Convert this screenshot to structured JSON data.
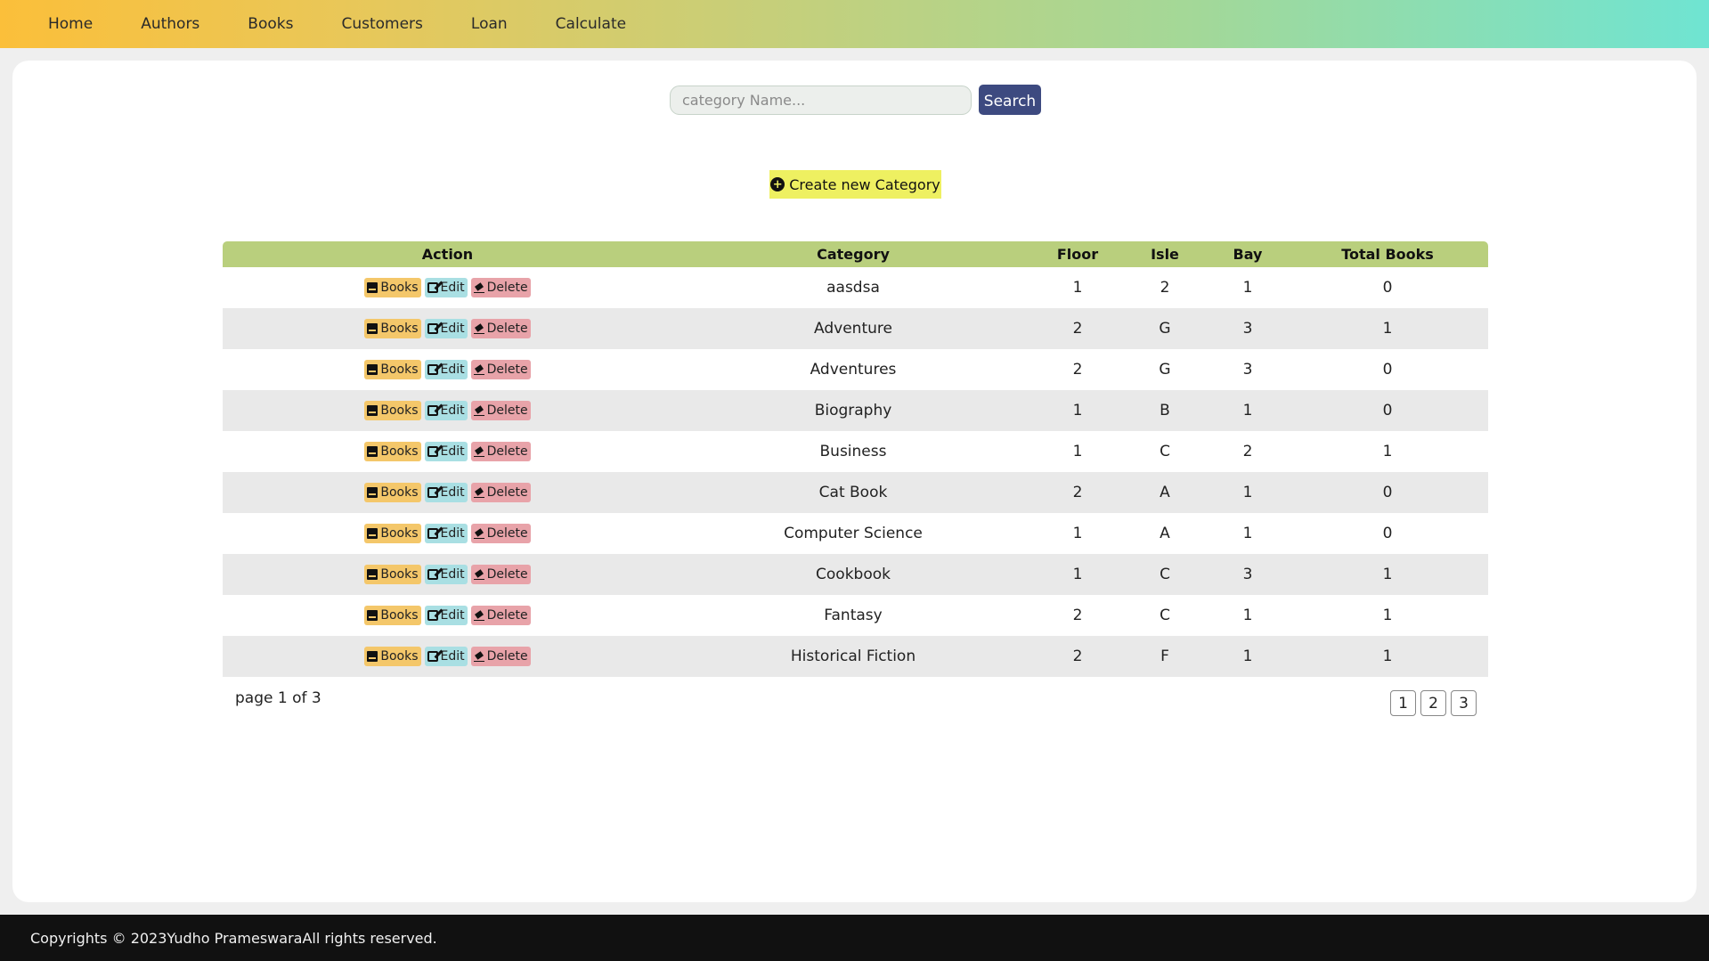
{
  "nav": {
    "items": [
      {
        "label": "Home"
      },
      {
        "label": "Authors"
      },
      {
        "label": "Books"
      },
      {
        "label": "Customers"
      },
      {
        "label": "Loan"
      },
      {
        "label": "Calculate"
      }
    ]
  },
  "search": {
    "placeholder": "category Name...",
    "value": "",
    "button_label": "Search"
  },
  "create_button": {
    "label": "Create new Category",
    "icon": "plus-circle-icon"
  },
  "table": {
    "columns": [
      "Action",
      "Category",
      "Floor",
      "Isle",
      "Bay",
      "Total Books"
    ],
    "action_labels": {
      "books": "Books",
      "edit": "Edit",
      "delete": "Delete"
    },
    "rows": [
      {
        "category": "aasdsa",
        "floor": "1",
        "isle": "2",
        "bay": "1",
        "total": "0"
      },
      {
        "category": "Adventure",
        "floor": "2",
        "isle": "G",
        "bay": "3",
        "total": "1"
      },
      {
        "category": "Adventures",
        "floor": "2",
        "isle": "G",
        "bay": "3",
        "total": "0"
      },
      {
        "category": "Biography",
        "floor": "1",
        "isle": "B",
        "bay": "1",
        "total": "0"
      },
      {
        "category": "Business",
        "floor": "1",
        "isle": "C",
        "bay": "2",
        "total": "1"
      },
      {
        "category": "Cat Book",
        "floor": "2",
        "isle": "A",
        "bay": "1",
        "total": "0"
      },
      {
        "category": "Computer Science",
        "floor": "1",
        "isle": "A",
        "bay": "1",
        "total": "0"
      },
      {
        "category": "Cookbook",
        "floor": "1",
        "isle": "C",
        "bay": "3",
        "total": "1"
      },
      {
        "category": "Fantasy",
        "floor": "2",
        "isle": "C",
        "bay": "1",
        "total": "1"
      },
      {
        "category": "Historical Fiction",
        "floor": "2",
        "isle": "F",
        "bay": "1",
        "total": "1"
      }
    ]
  },
  "pagination": {
    "info": "page 1 of 3",
    "pages": [
      "1",
      "2",
      "3"
    ]
  },
  "footer": {
    "text": "Copyrights © 2023Yudho PrameswaraAll rights reserved."
  },
  "colors": {
    "nav_gradient_start": "#fbbf3a",
    "nav_gradient_end": "#6fe4d2",
    "search_button": "#3d4a80",
    "create_button": "#eef061",
    "table_header": "#b9cf7d",
    "books_button": "#f4c76a",
    "edit_button": "#a9dfe3",
    "delete_button": "#e8a3a9",
    "footer": "#111111"
  }
}
